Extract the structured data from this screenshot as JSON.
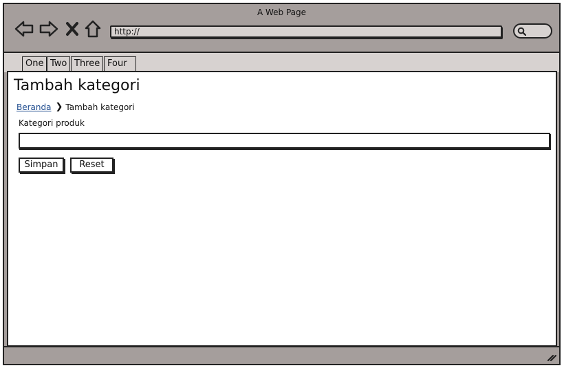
{
  "window": {
    "title": "A Web Page"
  },
  "toolbar": {
    "back_icon": "back-arrow-icon",
    "forward_icon": "forward-arrow-icon",
    "stop_icon": "close-icon",
    "home_icon": "home-icon",
    "url": "http://",
    "search_icon": "search-icon"
  },
  "tabs": [
    {
      "label": "One"
    },
    {
      "label": "Two"
    },
    {
      "label": "Three"
    },
    {
      "label": "Four"
    }
  ],
  "page": {
    "title": "Tambah kategori",
    "breadcrumb": {
      "home": "Beranda",
      "separator": "❯",
      "current": "Tambah kategori"
    },
    "field_label": "Kategori produk",
    "field_value": "",
    "buttons": {
      "save": "Simpan",
      "reset": "Reset"
    }
  },
  "colors": {
    "chrome": "#a59e9c",
    "tabstrip": "#d7d2d0",
    "link": "#1f4c8f"
  }
}
